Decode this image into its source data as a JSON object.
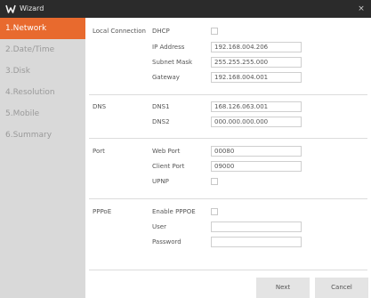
{
  "window": {
    "title": "Wizard",
    "logo_icon": "w-logo-icon",
    "close_icon": "close-icon",
    "close_glyph": "×"
  },
  "sidebar": {
    "items": [
      {
        "label": "1.Network"
      },
      {
        "label": "2.Date/Time"
      },
      {
        "label": "3.Disk"
      },
      {
        "label": "4.Resolution"
      },
      {
        "label": "5.Mobile"
      },
      {
        "label": "6.Summary"
      }
    ],
    "active_index": 0
  },
  "local_connection": {
    "section_label": "Local Connection",
    "dhcp_label": "DHCP",
    "dhcp_checked": false,
    "ip_label": "IP Address",
    "ip_value": "192.168.004.206",
    "mask_label": "Subnet Mask",
    "mask_value": "255.255.255.000",
    "gateway_label": "Gateway",
    "gateway_value": "192.168.004.001"
  },
  "dns": {
    "section_label": "DNS",
    "dns1_label": "DNS1",
    "dns1_value": "168.126.063.001",
    "dns2_label": "DNS2",
    "dns2_value": "000.000.000.000"
  },
  "port": {
    "section_label": "Port",
    "web_label": "Web Port",
    "web_value": "00080",
    "client_label": "Client Port",
    "client_value": "09000",
    "upnp_label": "UPNP",
    "upnp_checked": false
  },
  "pppoe": {
    "section_label": "PPPoE",
    "enable_label": "Enable PPPOE",
    "enable_checked": false,
    "user_label": "User",
    "user_value": "",
    "password_label": "Password",
    "password_value": ""
  },
  "footer": {
    "next_label": "Next",
    "cancel_label": "Cancel"
  },
  "colors": {
    "accent": "#e86a2e",
    "titlebar": "#2b2b2b",
    "sidebar": "#d9d9d9"
  }
}
